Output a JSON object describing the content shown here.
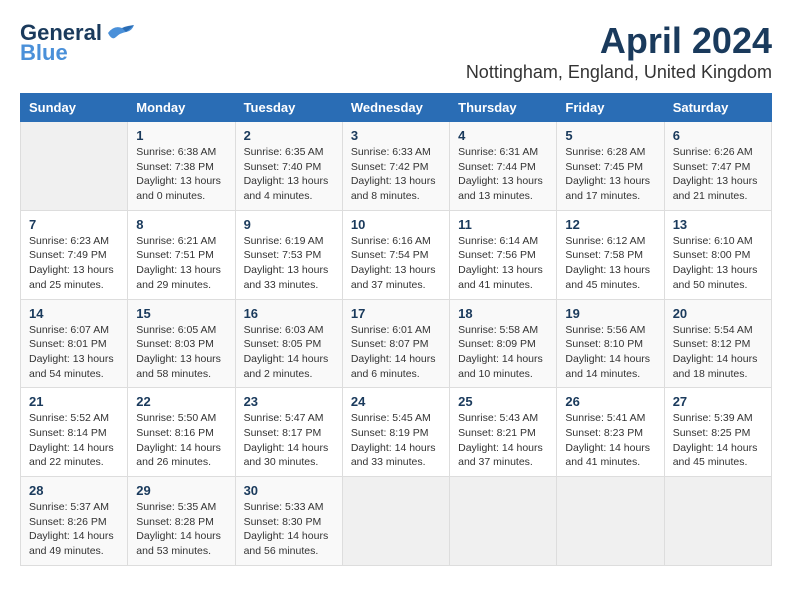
{
  "header": {
    "logo_general": "General",
    "logo_blue": "Blue",
    "title": "April 2024",
    "subtitle": "Nottingham, England, United Kingdom"
  },
  "days_of_week": [
    "Sunday",
    "Monday",
    "Tuesday",
    "Wednesday",
    "Thursday",
    "Friday",
    "Saturday"
  ],
  "weeks": [
    [
      {
        "day": "",
        "sunrise": "",
        "sunset": "",
        "daylight": ""
      },
      {
        "day": "1",
        "sunrise": "Sunrise: 6:38 AM",
        "sunset": "Sunset: 7:38 PM",
        "daylight": "Daylight: 13 hours and 0 minutes."
      },
      {
        "day": "2",
        "sunrise": "Sunrise: 6:35 AM",
        "sunset": "Sunset: 7:40 PM",
        "daylight": "Daylight: 13 hours and 4 minutes."
      },
      {
        "day": "3",
        "sunrise": "Sunrise: 6:33 AM",
        "sunset": "Sunset: 7:42 PM",
        "daylight": "Daylight: 13 hours and 8 minutes."
      },
      {
        "day": "4",
        "sunrise": "Sunrise: 6:31 AM",
        "sunset": "Sunset: 7:44 PM",
        "daylight": "Daylight: 13 hours and 13 minutes."
      },
      {
        "day": "5",
        "sunrise": "Sunrise: 6:28 AM",
        "sunset": "Sunset: 7:45 PM",
        "daylight": "Daylight: 13 hours and 17 minutes."
      },
      {
        "day": "6",
        "sunrise": "Sunrise: 6:26 AM",
        "sunset": "Sunset: 7:47 PM",
        "daylight": "Daylight: 13 hours and 21 minutes."
      }
    ],
    [
      {
        "day": "7",
        "sunrise": "Sunrise: 6:23 AM",
        "sunset": "Sunset: 7:49 PM",
        "daylight": "Daylight: 13 hours and 25 minutes."
      },
      {
        "day": "8",
        "sunrise": "Sunrise: 6:21 AM",
        "sunset": "Sunset: 7:51 PM",
        "daylight": "Daylight: 13 hours and 29 minutes."
      },
      {
        "day": "9",
        "sunrise": "Sunrise: 6:19 AM",
        "sunset": "Sunset: 7:53 PM",
        "daylight": "Daylight: 13 hours and 33 minutes."
      },
      {
        "day": "10",
        "sunrise": "Sunrise: 6:16 AM",
        "sunset": "Sunset: 7:54 PM",
        "daylight": "Daylight: 13 hours and 37 minutes."
      },
      {
        "day": "11",
        "sunrise": "Sunrise: 6:14 AM",
        "sunset": "Sunset: 7:56 PM",
        "daylight": "Daylight: 13 hours and 41 minutes."
      },
      {
        "day": "12",
        "sunrise": "Sunrise: 6:12 AM",
        "sunset": "Sunset: 7:58 PM",
        "daylight": "Daylight: 13 hours and 45 minutes."
      },
      {
        "day": "13",
        "sunrise": "Sunrise: 6:10 AM",
        "sunset": "Sunset: 8:00 PM",
        "daylight": "Daylight: 13 hours and 50 minutes."
      }
    ],
    [
      {
        "day": "14",
        "sunrise": "Sunrise: 6:07 AM",
        "sunset": "Sunset: 8:01 PM",
        "daylight": "Daylight: 13 hours and 54 minutes."
      },
      {
        "day": "15",
        "sunrise": "Sunrise: 6:05 AM",
        "sunset": "Sunset: 8:03 PM",
        "daylight": "Daylight: 13 hours and 58 minutes."
      },
      {
        "day": "16",
        "sunrise": "Sunrise: 6:03 AM",
        "sunset": "Sunset: 8:05 PM",
        "daylight": "Daylight: 14 hours and 2 minutes."
      },
      {
        "day": "17",
        "sunrise": "Sunrise: 6:01 AM",
        "sunset": "Sunset: 8:07 PM",
        "daylight": "Daylight: 14 hours and 6 minutes."
      },
      {
        "day": "18",
        "sunrise": "Sunrise: 5:58 AM",
        "sunset": "Sunset: 8:09 PM",
        "daylight": "Daylight: 14 hours and 10 minutes."
      },
      {
        "day": "19",
        "sunrise": "Sunrise: 5:56 AM",
        "sunset": "Sunset: 8:10 PM",
        "daylight": "Daylight: 14 hours and 14 minutes."
      },
      {
        "day": "20",
        "sunrise": "Sunrise: 5:54 AM",
        "sunset": "Sunset: 8:12 PM",
        "daylight": "Daylight: 14 hours and 18 minutes."
      }
    ],
    [
      {
        "day": "21",
        "sunrise": "Sunrise: 5:52 AM",
        "sunset": "Sunset: 8:14 PM",
        "daylight": "Daylight: 14 hours and 22 minutes."
      },
      {
        "day": "22",
        "sunrise": "Sunrise: 5:50 AM",
        "sunset": "Sunset: 8:16 PM",
        "daylight": "Daylight: 14 hours and 26 minutes."
      },
      {
        "day": "23",
        "sunrise": "Sunrise: 5:47 AM",
        "sunset": "Sunset: 8:17 PM",
        "daylight": "Daylight: 14 hours and 30 minutes."
      },
      {
        "day": "24",
        "sunrise": "Sunrise: 5:45 AM",
        "sunset": "Sunset: 8:19 PM",
        "daylight": "Daylight: 14 hours and 33 minutes."
      },
      {
        "day": "25",
        "sunrise": "Sunrise: 5:43 AM",
        "sunset": "Sunset: 8:21 PM",
        "daylight": "Daylight: 14 hours and 37 minutes."
      },
      {
        "day": "26",
        "sunrise": "Sunrise: 5:41 AM",
        "sunset": "Sunset: 8:23 PM",
        "daylight": "Daylight: 14 hours and 41 minutes."
      },
      {
        "day": "27",
        "sunrise": "Sunrise: 5:39 AM",
        "sunset": "Sunset: 8:25 PM",
        "daylight": "Daylight: 14 hours and 45 minutes."
      }
    ],
    [
      {
        "day": "28",
        "sunrise": "Sunrise: 5:37 AM",
        "sunset": "Sunset: 8:26 PM",
        "daylight": "Daylight: 14 hours and 49 minutes."
      },
      {
        "day": "29",
        "sunrise": "Sunrise: 5:35 AM",
        "sunset": "Sunset: 8:28 PM",
        "daylight": "Daylight: 14 hours and 53 minutes."
      },
      {
        "day": "30",
        "sunrise": "Sunrise: 5:33 AM",
        "sunset": "Sunset: 8:30 PM",
        "daylight": "Daylight: 14 hours and 56 minutes."
      },
      {
        "day": "",
        "sunrise": "",
        "sunset": "",
        "daylight": ""
      },
      {
        "day": "",
        "sunrise": "",
        "sunset": "",
        "daylight": ""
      },
      {
        "day": "",
        "sunrise": "",
        "sunset": "",
        "daylight": ""
      },
      {
        "day": "",
        "sunrise": "",
        "sunset": "",
        "daylight": ""
      }
    ]
  ]
}
